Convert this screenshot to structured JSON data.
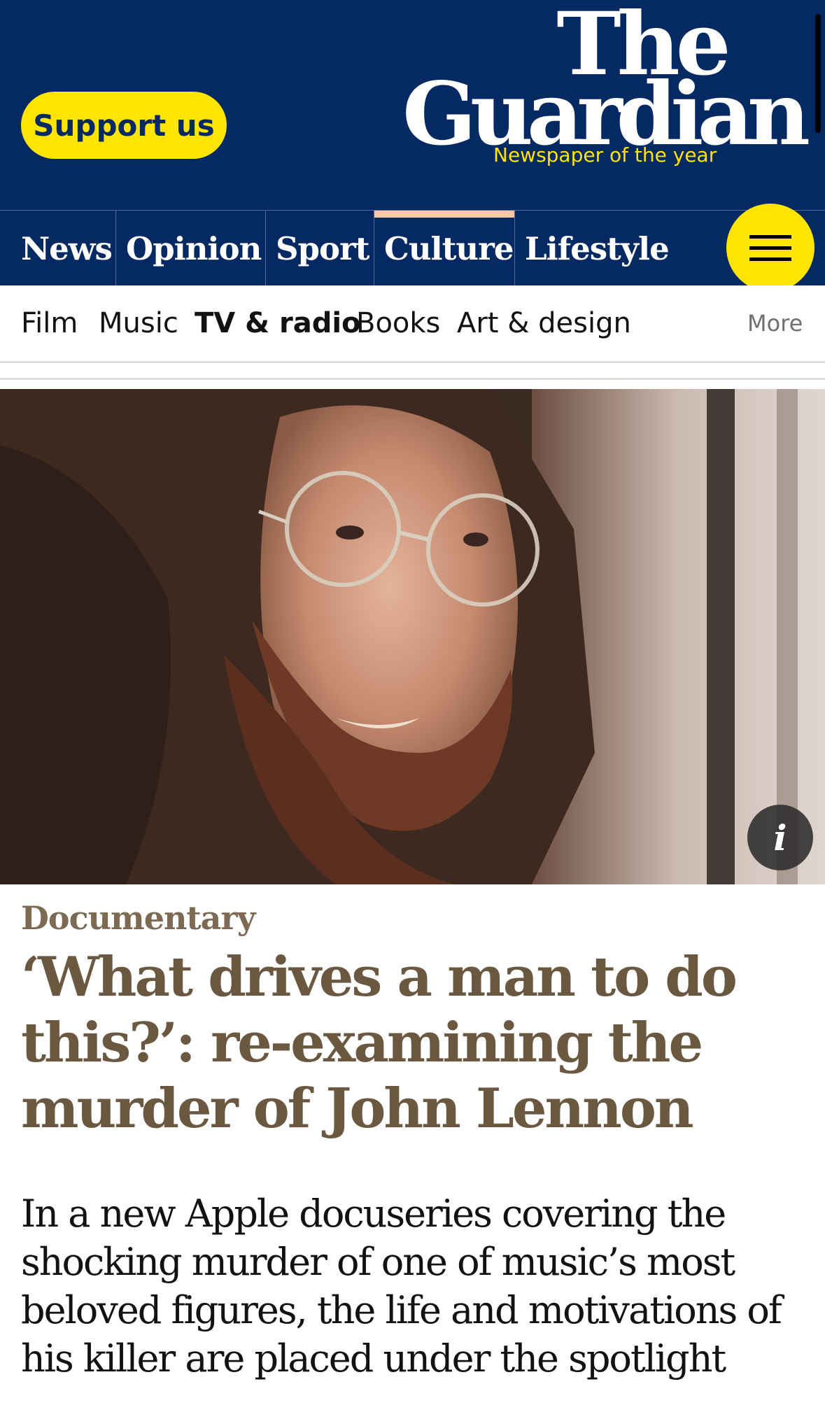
{
  "header": {
    "support_label": "Support us",
    "logo_line1": "The",
    "logo_line2": "Guardian",
    "tagline": "Newspaper of the year"
  },
  "pillars": {
    "items": [
      "News",
      "Opinion",
      "Sport",
      "Culture",
      "Lifestyle"
    ],
    "active": "Culture"
  },
  "subnav": {
    "items": [
      "Film",
      "Music",
      "TV & radio",
      "Books",
      "Art & design"
    ],
    "active": "TV & radio",
    "more_label": "More"
  },
  "hero": {
    "info_icon": "info-icon",
    "info_glyph": "i"
  },
  "article": {
    "kicker": "Documentary",
    "headline": "‘What drives a man to do this?’: re-examining the murder of John Lennon",
    "standfirst": "In a new Apple docuseries covering the shocking murder of one of music’s most beloved figures, the life and motivations of his killer are placed under the spotlight"
  },
  "colors": {
    "brand_blue": "#052962",
    "support_yellow": "#ffe500",
    "culture_accent": "#fec8a5",
    "headline_brown": "#6b5840"
  }
}
